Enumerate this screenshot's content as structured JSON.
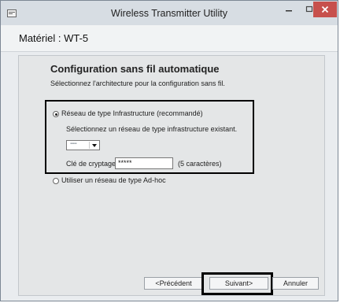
{
  "window": {
    "title": "Wireless Transmitter Utility"
  },
  "device": {
    "label": "Matériel : WT-5"
  },
  "main": {
    "heading": "Configuration sans fil automatique",
    "instruction": "Sélectionnez l'architecture pour la configuration sans fil.",
    "infrastructure_option": {
      "label": "Réseau de type Infrastructure (recommandé)",
      "selected": true
    },
    "select_network_text": "Sélectionnez un réseau de type infrastructure existant.",
    "network_select": {
      "value": "▪▪▪▪▪"
    },
    "key": {
      "label": "Clé de cryptage",
      "value": "*****",
      "hint": "(5 caractères)"
    },
    "adhoc_option": {
      "label": "Utiliser un réseau de type Ad-hoc",
      "selected": false
    }
  },
  "buttons": {
    "previous": "<Précédent",
    "next": "Suivant>",
    "cancel": "Annuler"
  },
  "icons": {
    "app": "app-icon",
    "minimize": "minimize-icon",
    "maximize": "maximize-icon",
    "close": "close-icon"
  }
}
